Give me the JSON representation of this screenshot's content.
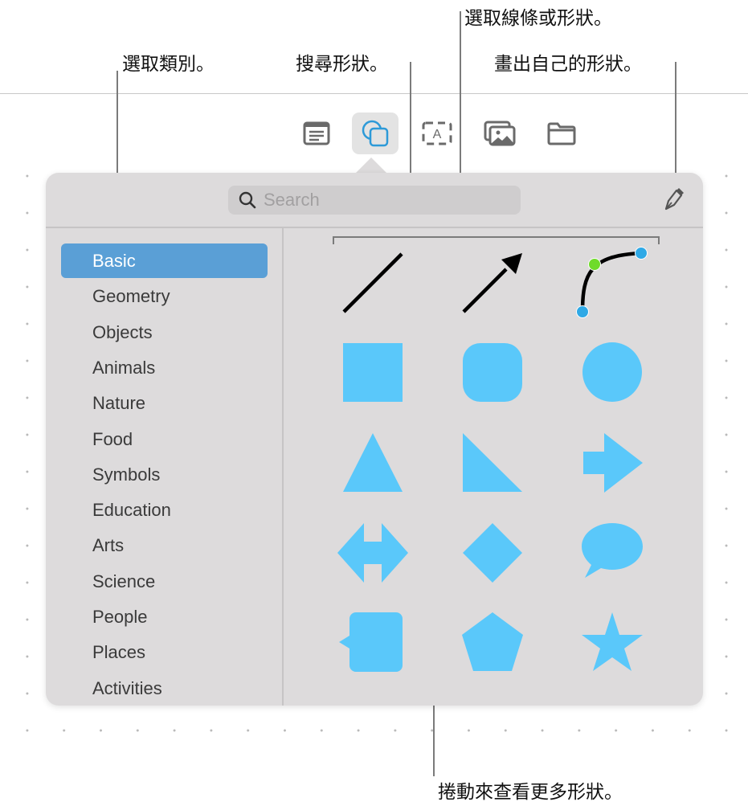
{
  "callouts": {
    "choose_category": "選取類別。",
    "search_shapes": "搜尋形狀。",
    "choose_line_or_shape": "選取線條或形狀。",
    "draw_own_shape": "畫出自己的形狀。",
    "scroll_more": "捲動來查看更多形狀。"
  },
  "toolbar": {
    "items": [
      "text-box-icon",
      "shapes-icon",
      "text-icon",
      "media-icon",
      "folder-icon"
    ],
    "active": "shapes-icon",
    "text_icon_letter": "A"
  },
  "search": {
    "placeholder": "Search",
    "value": ""
  },
  "categories": {
    "selected": "Basic",
    "items": [
      "Basic",
      "Geometry",
      "Objects",
      "Animals",
      "Nature",
      "Food",
      "Symbols",
      "Education",
      "Arts",
      "Science",
      "People",
      "Places",
      "Activities"
    ]
  },
  "shapes": [
    "line",
    "arrow",
    "curve",
    "square",
    "rounded-square",
    "circle",
    "triangle",
    "right-triangle",
    "arrow-right",
    "double-arrow",
    "diamond",
    "speech-bubble",
    "callout-square",
    "pentagon",
    "star"
  ],
  "colors": {
    "shape": "#5ac8fa",
    "selected": "#5a9fd6",
    "panel": "#dddbdc",
    "curve_handle": "#2fa9e6",
    "curve_control": "#6fdb2a"
  }
}
